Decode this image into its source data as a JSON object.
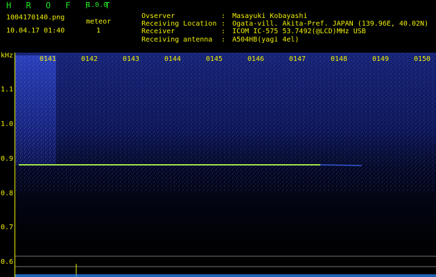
{
  "app": {
    "title": "H R O F F T",
    "version": "1.0.0"
  },
  "file": {
    "name": "1004170140.png",
    "datetime": "10.04.17 01:40"
  },
  "meteor": {
    "label": "meteor",
    "count": "1"
  },
  "info": [
    {
      "key": "Ovserver",
      "sep": ":",
      "value": "Masayuki Kobayashi"
    },
    {
      "key": "Receiving Location",
      "sep": ":",
      "value": "Ogata-vill. Akita-Pref. JAPAN (139.96E, 40.02N)"
    },
    {
      "key": "Receiver",
      "sep": ":",
      "value": "ICOM IC-575 53.7492(@LCD)MHz USB"
    },
    {
      "key": "Receiving antenna",
      "sep": ":",
      "value": "A504HB(yagi 4el)"
    }
  ],
  "axes": {
    "y_unit": "kHz",
    "y_ticks": [
      "1.1",
      "1.0",
      "0.9",
      "0.8",
      "0.7",
      "0.6"
    ],
    "x_ticks": [
      "0141",
      "0142",
      "0143",
      "0144",
      "0145",
      "0146",
      "0147",
      "0148",
      "0149",
      "0150"
    ]
  },
  "colors": {
    "background": "#000000",
    "text": "#f0f000",
    "title": "#21e421",
    "signal": "#2a4cff",
    "trace": "#9fe64a"
  }
}
